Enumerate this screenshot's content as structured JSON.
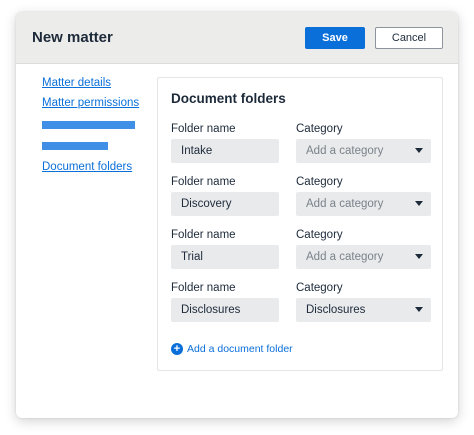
{
  "header": {
    "title": "New matter",
    "save_label": "Save",
    "cancel_label": "Cancel"
  },
  "sidebar": {
    "items": [
      {
        "label": "Matter details"
      },
      {
        "label": "Matter permissions"
      },
      {
        "label": "Document folders"
      }
    ]
  },
  "panel": {
    "title": "Document folders",
    "folder_name_label": "Folder name",
    "category_label": "Category",
    "rows": [
      {
        "folder_name": "Intake",
        "category": "Add a category",
        "category_is_placeholder": true
      },
      {
        "folder_name": "Discovery",
        "category": "Add a category",
        "category_is_placeholder": true
      },
      {
        "folder_name": "Trial",
        "category": "Add a category",
        "category_is_placeholder": true
      },
      {
        "folder_name": "Disclosures",
        "category": "Disclosures",
        "category_is_placeholder": false
      }
    ],
    "add_folder_label": "Add a document folder"
  },
  "colors": {
    "accent": "#0a6fd9",
    "header_bg": "#ececea",
    "field_bg": "#e9eaec"
  }
}
